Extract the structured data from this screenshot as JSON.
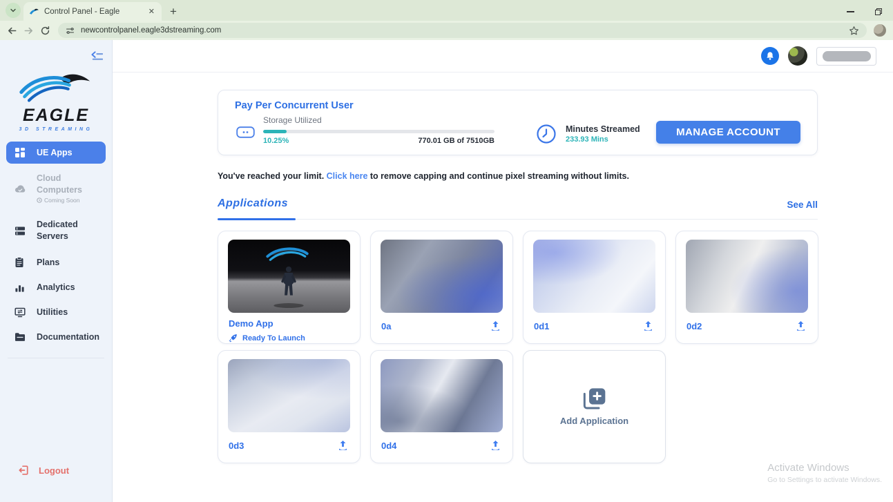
{
  "browser": {
    "tab_title": "Control Panel - Eagle",
    "url": "newcontrolpanel.eagle3dstreaming.com",
    "close_glyph": "✕",
    "new_tab_glyph": "+"
  },
  "sidebar": {
    "logo_title": "EAGLE",
    "logo_subtitle": "3D STREAMING",
    "items": [
      {
        "label": "UE Apps"
      },
      {
        "label": "Cloud Computers",
        "sub": "Coming Soon"
      },
      {
        "label": "Dedicated Servers"
      },
      {
        "label": "Plans"
      },
      {
        "label": "Analytics"
      },
      {
        "label": "Utilities"
      },
      {
        "label": "Documentation"
      }
    ],
    "logout_label": "Logout"
  },
  "billing": {
    "plan_title": "Pay Per Concurrent User",
    "storage_label": "Storage Utilized",
    "storage_percent": "10.25%",
    "storage_detail": "770.01 GB of 7510GB",
    "storage_fill_style": "width:10.25%",
    "minutes_label": "Minutes Streamed",
    "minutes_value": "233.93 Mins",
    "manage_button_label": "MANAGE ACCOUNT"
  },
  "limit_notice": {
    "prefix": "You've reached your limit. ",
    "link_text": "Click here",
    "suffix": " to remove capping and continue pixel streaming without limits."
  },
  "applications": {
    "section_title": "Applications",
    "see_all_label": "See All",
    "cards": [
      {
        "name": "Demo App",
        "status": "Ready To Launch"
      },
      {
        "name": "0a"
      },
      {
        "name": "0d1"
      },
      {
        "name": "0d2"
      },
      {
        "name": "0d3"
      },
      {
        "name": "0d4"
      }
    ],
    "add_card_label": "Add Application"
  },
  "watermark": {
    "line1": "Activate Windows",
    "line2": "Go to Settings to activate Windows."
  },
  "colors": {
    "accent_blue": "#3070e8",
    "active_nav_blue": "#4b80e9",
    "teal": "#2cb4b8",
    "button_blue": "#4480e8",
    "logout_red": "#e4716c",
    "chrome_green": "#dde8d6"
  }
}
